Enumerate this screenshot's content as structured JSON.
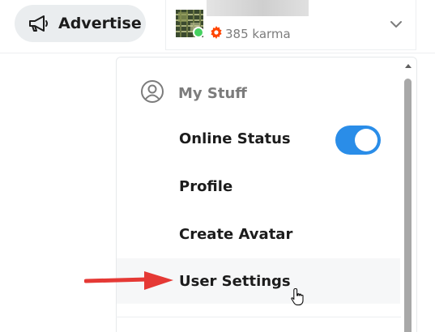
{
  "header": {
    "advertise_label": "Advertise",
    "karma_text": "385 karma"
  },
  "menu": {
    "section_title": "My Stuff",
    "items": [
      {
        "label": "Online Status",
        "toggle_on": true
      },
      {
        "label": "Profile"
      },
      {
        "label": "Create Avatar"
      },
      {
        "label": "User Settings"
      }
    ]
  },
  "colors": {
    "toggle_on": "#2a8de8",
    "online_dot": "#46d160",
    "karma_icon": "#ff4500",
    "annotation_arrow": "#e53935"
  }
}
